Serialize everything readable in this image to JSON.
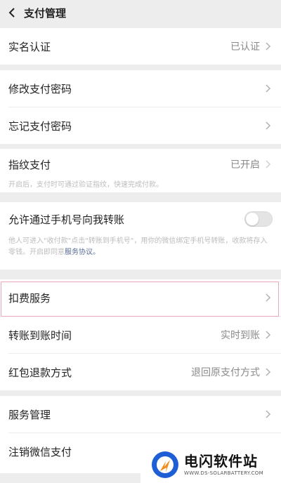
{
  "header": {
    "title": "支付管理"
  },
  "identity": {
    "label": "实名认证",
    "value": "已认证"
  },
  "password": {
    "change_label": "修改支付密码",
    "forgot_label": "忘记支付密码"
  },
  "fingerprint": {
    "label": "指纹支付",
    "value": "已开启",
    "description": "开启后，支付时可通过验证指纹，快速完成付款。"
  },
  "phone_transfer": {
    "label": "允许通过手机号向我转账",
    "enabled": false,
    "description": "他人可进入\"收付款\"点击\"转账到手机号\"，用你的微信绑定手机号转账，收款将存入零钱。开启即同意",
    "link": "服务协议。"
  },
  "deduction": {
    "label": "扣费服务"
  },
  "arrival_time": {
    "label": "转账到账时间",
    "value": "实时到账"
  },
  "red_packet": {
    "label": "红包退款方式",
    "value": "退回原支付方式"
  },
  "service_mgmt": {
    "label": "服务管理"
  },
  "cancel_pay": {
    "label": "注销微信支付"
  },
  "watermark": {
    "name": "电闪软件站",
    "url": "WWW.DS-SOLARBATTERY.COM",
    "colors": {
      "blue": "#1e5fd6",
      "orange": "#f08a1c"
    }
  }
}
